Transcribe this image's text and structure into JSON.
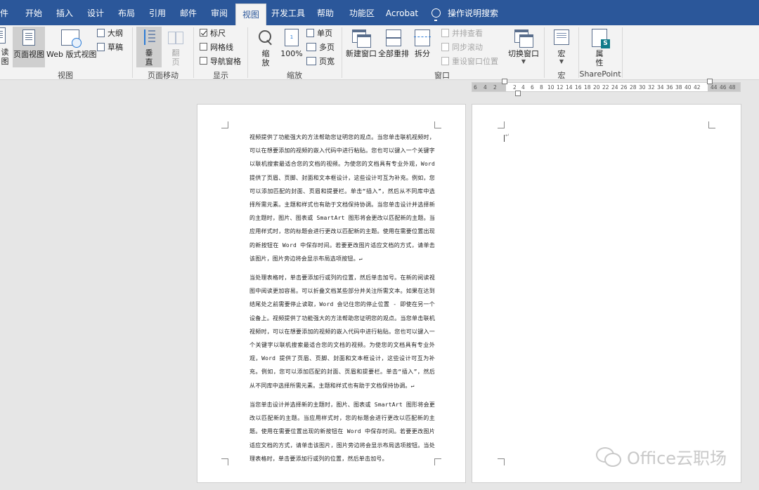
{
  "tabs": [
    {
      "label": "件",
      "active": false
    },
    {
      "label": "开始",
      "active": false
    },
    {
      "label": "插入",
      "active": false
    },
    {
      "label": "设计",
      "active": false
    },
    {
      "label": "布局",
      "active": false
    },
    {
      "label": "引用",
      "active": false
    },
    {
      "label": "邮件",
      "active": false
    },
    {
      "label": "审阅",
      "active": false
    },
    {
      "label": "视图",
      "active": true
    },
    {
      "label": "开发工具",
      "active": false
    },
    {
      "label": "帮助",
      "active": false
    },
    {
      "label": "功能区",
      "active": false
    },
    {
      "label": "Acrobat",
      "active": false
    },
    {
      "label": "操作说明搜索",
      "active": false
    }
  ],
  "ribbon": {
    "views": {
      "read_label_top": "读",
      "read_label_bottom": "图",
      "print_layout": "页面视图",
      "web_layout": "Web 版式视图",
      "outline": "大纲",
      "draft": "草稿",
      "group": "视图"
    },
    "page_movement": {
      "vertical_top": "垂",
      "vertical_bottom": "直",
      "side_top": "翻",
      "side_bottom": "页",
      "group": "页面移动"
    },
    "show": {
      "ruler": "标尺",
      "ruler_checked": true,
      "gridlines": "网格线",
      "gridlines_checked": false,
      "nav_pane": "导航窗格",
      "nav_pane_checked": false,
      "group": "显示"
    },
    "zoom": {
      "zoom_top": "缩",
      "zoom_bottom": "放",
      "hundred": "100%",
      "one_page": "单页",
      "multi_page": "多页",
      "page_width": "页宽",
      "group": "缩放"
    },
    "window": {
      "new_window": "新建窗口",
      "arrange_all": "全部重排",
      "split": "拆分",
      "side_by_side": "并排查看",
      "sync_scroll": "同步滚动",
      "reset_position": "重设窗口位置",
      "switch_windows": "切换窗口",
      "group": "窗口"
    },
    "macros": {
      "label": "宏",
      "group": "宏"
    },
    "sharepoint": {
      "props_top": "属",
      "props_bottom": "性",
      "group": "SharePoint"
    }
  },
  "ruler": {
    "ticks": [
      "6",
      "4",
      "2",
      "",
      "2",
      "4",
      "6",
      "8",
      "10",
      "12",
      "14",
      "16",
      "18",
      "20",
      "22",
      "24",
      "26",
      "28",
      "30",
      "32",
      "34",
      "36",
      "38",
      "40",
      "42",
      "44",
      "46",
      "48"
    ]
  },
  "document": {
    "paragraphs": [
      "视频提供了功能强大的方法帮助您证明您的观点。当您单击联机视频时，可以在想要添加的视频的嵌入代码中进行粘贴。您也可以键入一个关键字以联机搜索最适合您的文档的视频。为使您的文档具有专业外观，Word 提供了页眉、页脚、封面和文本框设计，这些设计可互为补充。例如，您可以添加匹配的封面、页眉和提要栏。单击“插入”，然后从不同库中选择所需元素。主题和样式也有助于文档保持协调。当您单击设计并选择新的主题时，图片、图表或 SmartArt 图形将会更改以匹配新的主题。当应用样式时，您的标题会进行更改以匹配新的主题。使用在需要位置出现的新按钮在 Word 中保存时间。若要更改图片适应文档的方式，请单击该图片，图片旁边将会显示布局选项按钮。↵",
      "当处理表格时，单击要添加行或列的位置，然后单击加号。在新的阅读视图中阅读更加容易。可以折叠文档某些部分并关注所需文本。如果在达到结尾处之前需要停止读取，Word 会记住您的停止位置 - 即使在另一个设备上。视频提供了功能强大的方法帮助您证明您的观点。当您单击联机视频时，可以在想要添加的视频的嵌入代码中进行粘贴。您也可以键入一个关键字以联机搜索最适合您的文档的视频。为使您的文档具有专业外观，Word 提供了页眉、页脚、封面和文本框设计，这些设计可互为补充。例如，您可以添加匹配的封面、页眉和提要栏。单击“插入”，然后从不同库中选择所需元素。主题和样式也有助于文档保持协调。↵",
      "当您单击设计并选择新的主题时，图片、图表或 SmartArt 图形将会更改以匹配新的主题。当应用样式时，您的标题会进行更改以匹配新的主题。使用在需要位置出现的新按钮在 Word 中保存时间。若要更改图片适应文档的方式，请单击该图片，图片旁边将会显示布局选项按钮。当处理表格时，单击要添加行或列的位置，然后单击加号。"
    ],
    "page2_mark": "↵"
  },
  "watermark": {
    "text": "Office云职场",
    "icon": "wechat-icon"
  }
}
